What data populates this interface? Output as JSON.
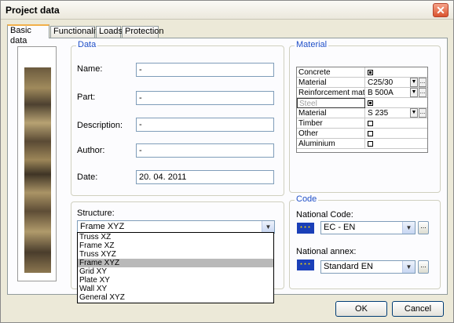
{
  "window": {
    "title": "Project data",
    "close_icon": "✕"
  },
  "tabs": [
    "Basic data",
    "Functionality",
    "Loads",
    "Protection"
  ],
  "data_group": {
    "legend": "Data",
    "name_label": "Name:",
    "name_value": "-",
    "part_label": "Part:",
    "part_value": "-",
    "description_label": "Description:",
    "description_value": "-",
    "author_label": "Author:",
    "author_value": "-",
    "date_label": "Date:",
    "date_value": "20. 04. 2011",
    "structure_label": "Structure:",
    "structure_value": "Frame XYZ",
    "structure_options": [
      "Truss XZ",
      "Frame XZ",
      "Truss XYZ",
      "Frame XYZ",
      "Grid XY",
      "Plate XY",
      "Wall XY",
      "General XYZ"
    ],
    "structure_selected_index": 3
  },
  "material_group": {
    "legend": "Material",
    "rows": [
      {
        "name": "Concrete",
        "kind": "check",
        "checked": true
      },
      {
        "name": "Material",
        "kind": "combo",
        "value": "C25/30"
      },
      {
        "name": "Reinforcement mat...",
        "kind": "combo",
        "value": "B 500A"
      },
      {
        "name": "Steel",
        "kind": "check",
        "checked": true,
        "selected": true
      },
      {
        "name": "Material",
        "kind": "combo",
        "value": "S 235"
      },
      {
        "name": "Timber",
        "kind": "check",
        "checked": false
      },
      {
        "name": "Other",
        "kind": "check",
        "checked": false
      },
      {
        "name": "Aluminium",
        "kind": "check",
        "checked": false
      }
    ]
  },
  "code_group": {
    "legend": "Code",
    "national_code_label": "National Code:",
    "national_code_value": "EC - EN",
    "national_annex_label": "National annex:",
    "national_annex_value": "Standard EN",
    "flag_icon": "eu-flag-icon"
  },
  "buttons": {
    "ok": "OK",
    "cancel": "Cancel"
  },
  "colors": {
    "accent": "#2050c8",
    "flag": "#1a3fb8",
    "window_bg": "#ece9d8"
  }
}
